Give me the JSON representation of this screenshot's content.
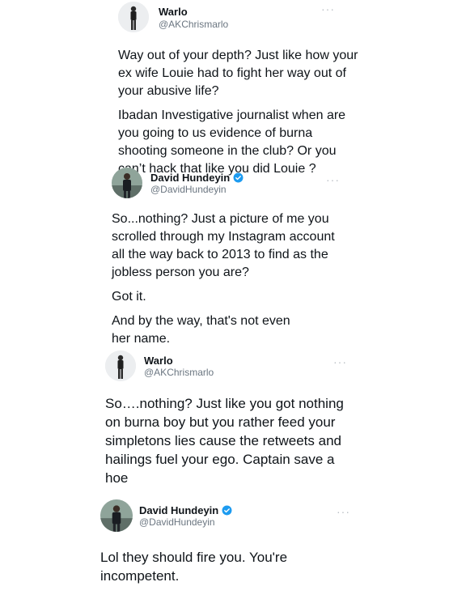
{
  "icons": {
    "avatar": "person-photo",
    "more": "more-options-icon",
    "verified": "verified-badge-icon"
  },
  "colors": {
    "verified": "#1d9bf0",
    "text": "#0f1419",
    "handle": "#6b7681"
  },
  "tweets": [
    {
      "name": "Warlo",
      "handle": "@AKChrismarlo",
      "more": "···",
      "paragraphs": [
        "Way out of your depth? Just like how your ex wife Louie had to fight her way out of your abusive life?",
        "Ibadan Investigative journalist when are you going to us evidence of burna shooting someone in the club? Or you can’t hack that like you did Louie ?"
      ]
    },
    {
      "name": "David Hundeyin",
      "handle": "@DavidHundeyin",
      "more": "···",
      "verified": true,
      "paragraphs": [
        "So...nothing? Just a picture of me you scrolled through my Instagram account all the way back to 2013 to find as the jobless person you are?",
        "Got it.",
        "And by the way, that's not even her name."
      ]
    },
    {
      "name": "Warlo",
      "handle": "@AKChrismarlo",
      "more": "···",
      "paragraphs": [
        "So….nothing? Just like you got nothing on burna boy but you rather feed your simpletons lies cause the retweets and hailings fuel your ego. Captain save a hoe"
      ]
    },
    {
      "name": "David Hundeyin",
      "handle": "@DavidHundeyin",
      "more": "···",
      "verified": true,
      "paragraphs": [
        "Lol they should fire you. You're incompetent."
      ]
    }
  ]
}
